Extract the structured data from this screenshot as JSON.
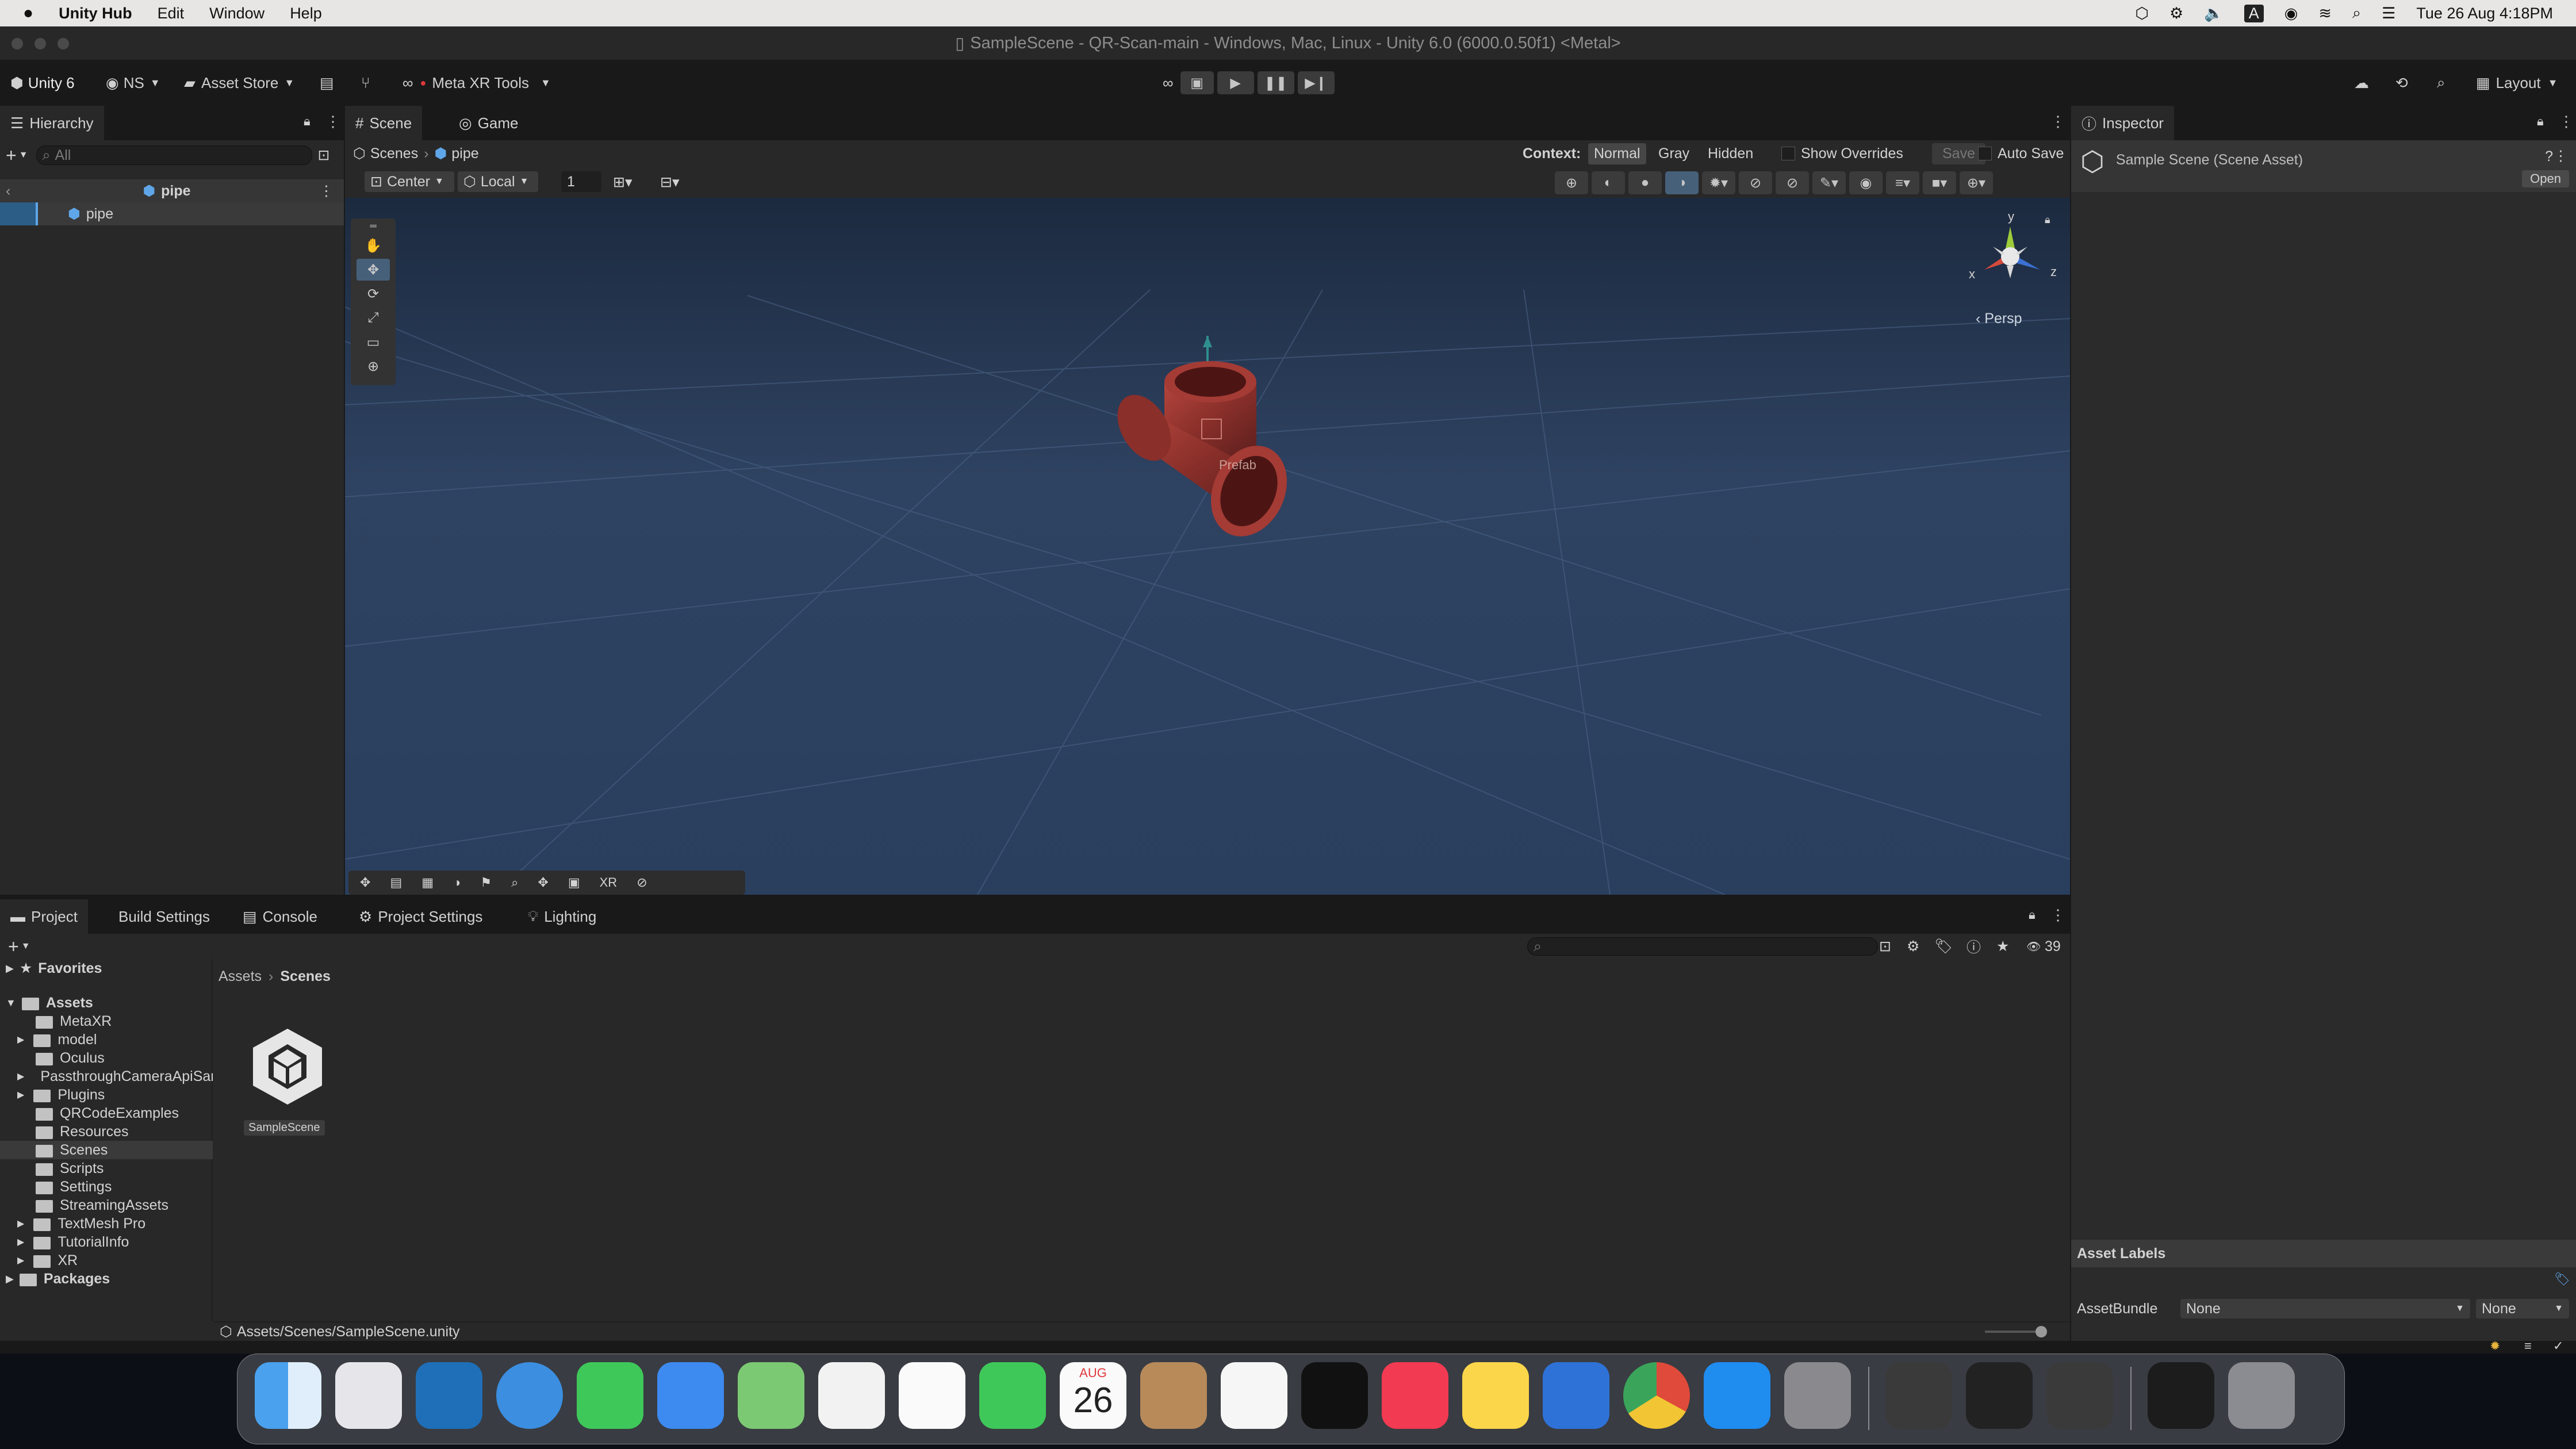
{
  "menubar": {
    "app": "Unity Hub",
    "items": [
      "Edit",
      "Window",
      "Help"
    ],
    "clock": "Tue 26 Aug  4:18PM"
  },
  "window": {
    "title": "SampleScene - QR-Scan-main - Windows, Mac, Linux - Unity 6.0 (6000.0.50f1) <Metal>"
  },
  "toolbar": {
    "unity": "Unity 6",
    "account": "NS",
    "asset_store": "Asset Store",
    "meta_xr": "Meta XR Tools",
    "layout": "Layout"
  },
  "hierarchy": {
    "tab": "Hierarchy",
    "search_placeholder": "All",
    "scene": "pipe",
    "item": "pipe"
  },
  "scene": {
    "tabs": [
      "Scene",
      "Game"
    ],
    "breadcrumb_root": "Scenes",
    "breadcrumb_item": "pipe",
    "context_label": "Context:",
    "context_options": [
      "Normal",
      "Gray",
      "Hidden"
    ],
    "show_overrides": "Show Overrides",
    "save": "Save",
    "auto_save": "Auto Save",
    "pivot": "Center",
    "space": "Local",
    "grid_snap": "1",
    "persp": "Persp",
    "gizmo_axes": [
      "y",
      "x",
      "z"
    ],
    "prefab_label": "Prefab",
    "bottom_overlay_xr": "XR"
  },
  "inspector": {
    "tab": "Inspector",
    "title": "Sample Scene (Scene Asset)",
    "open": "Open",
    "asset_labels": "Asset Labels",
    "asset_bundle": "AssetBundle",
    "bundle_value": "None",
    "variant_value": "None"
  },
  "project": {
    "tabs": [
      "Project",
      "Build Settings",
      "Console",
      "Project Settings",
      "Lighting"
    ],
    "count": "39",
    "favorites": "Favorites",
    "assets": "Assets",
    "packages": "Packages",
    "folders": [
      "MetaXR",
      "model",
      "Oculus",
      "PassthroughCameraApiSamples",
      "Plugins",
      "QRCodeExamples",
      "Resources",
      "Scenes",
      "Scripts",
      "Settings",
      "StreamingAssets",
      "TextMesh Pro",
      "TutorialInfo",
      "XR"
    ],
    "breadcrumb": [
      "Assets",
      "Scenes"
    ],
    "asset_name": "SampleScene",
    "path": "Assets/Scenes/SampleScene.unity"
  },
  "dock": {
    "calendar_month": "AUG",
    "calendar_day": "26",
    "apps": [
      "Finder",
      "Launchpad",
      "Visual Studio Code",
      "Safari",
      "Messages",
      "Mail",
      "Maps",
      "Photos",
      "Reminders",
      "FaceTime",
      "Calendar",
      "Contacts",
      "Freeform",
      "TV",
      "Music",
      "Notes",
      "Xcode",
      "Chrome",
      "App Store",
      "System Settings",
      "Unity Hub",
      "Unity",
      "Unity 6",
      "Screenshot",
      "Trash"
    ]
  }
}
